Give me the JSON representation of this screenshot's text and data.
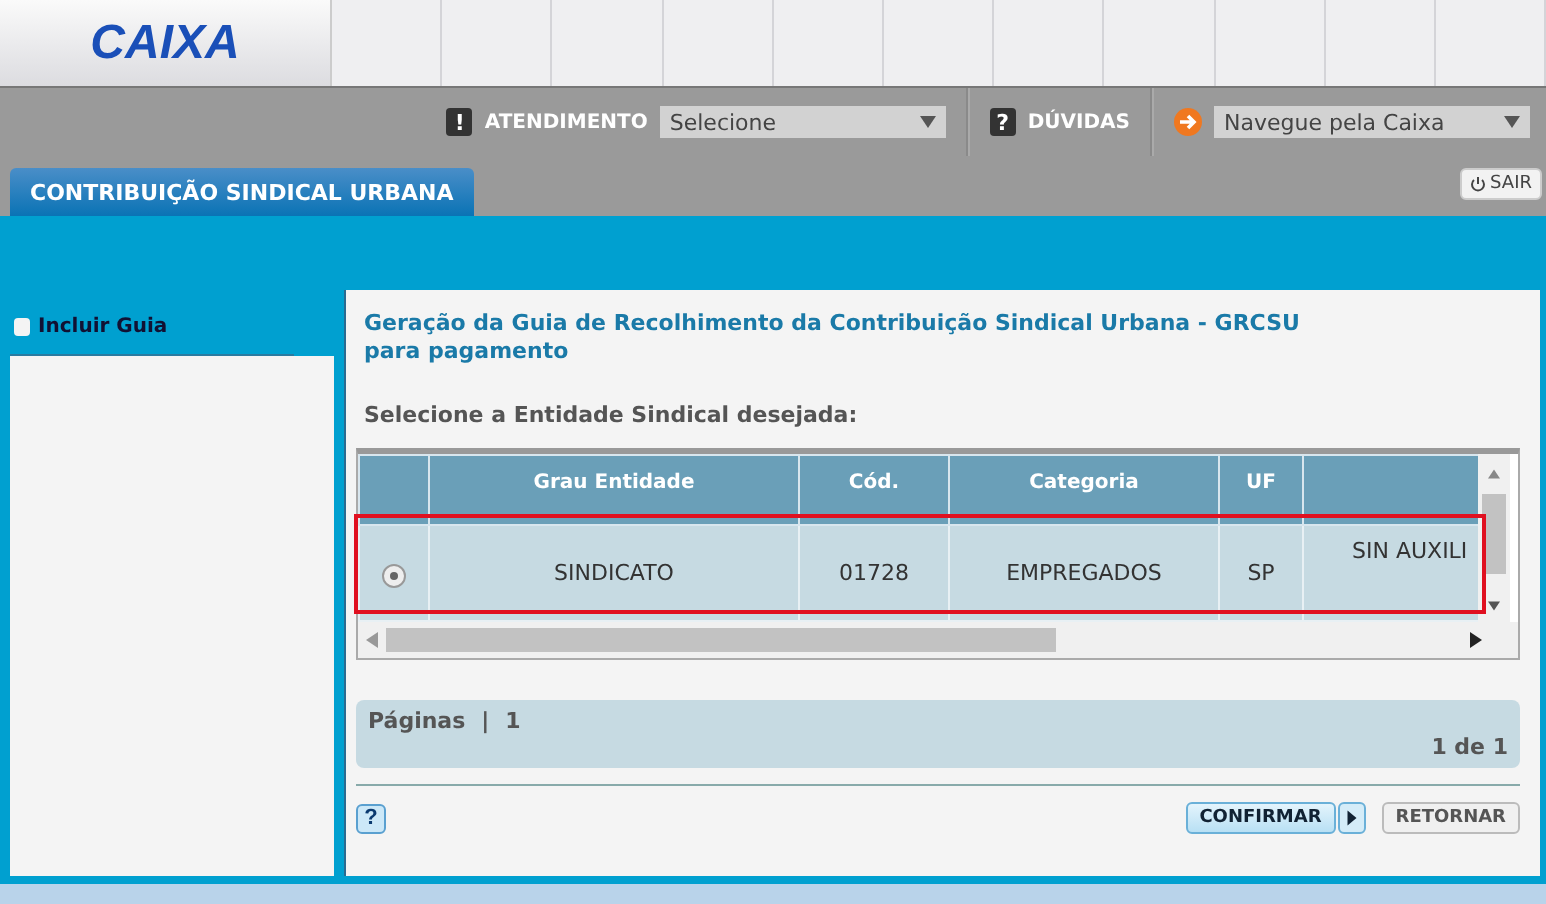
{
  "header": {
    "logo": "CAIXA"
  },
  "nav": {
    "atendimento": {
      "icon": "!",
      "label": "ATENDIMENTO",
      "value": "Selecione"
    },
    "duvidas": {
      "icon": "?",
      "label": "DÚVIDAS"
    },
    "navegue": {
      "value": "Navegue pela Caixa"
    }
  },
  "tab": {
    "label": "CONTRIBUIÇÃO SINDICAL URBANA",
    "selected": true
  },
  "sair": "SAIR",
  "sidebar": {
    "items": [
      {
        "label": "Incluir Guia",
        "selected": false
      }
    ]
  },
  "content": {
    "title": "Geração da Guia de Recolhimento da Contribuição Sindical Urbana - GRCSU para pagamento",
    "prompt": "Selecione a Entidade Sindical desejada:",
    "table": {
      "columns": [
        "",
        "Grau Entidade",
        "Cód.",
        "Categoria",
        "UF",
        ""
      ],
      "rows": [
        {
          "selected": true,
          "cells": [
            "",
            "SINDICATO",
            "01728",
            "EMPREGADOS",
            "SP",
            "SIN AUXILI"
          ]
        }
      ]
    },
    "pagination": {
      "label": "Páginas",
      "separator": "|",
      "pages": [
        "1"
      ],
      "summary": "1 de 1"
    },
    "help": "?",
    "buttons": [
      {
        "label": "CONFIRMAR",
        "kind": "primary"
      },
      {
        "label": "RETORNAR",
        "kind": "secondary"
      }
    ]
  }
}
